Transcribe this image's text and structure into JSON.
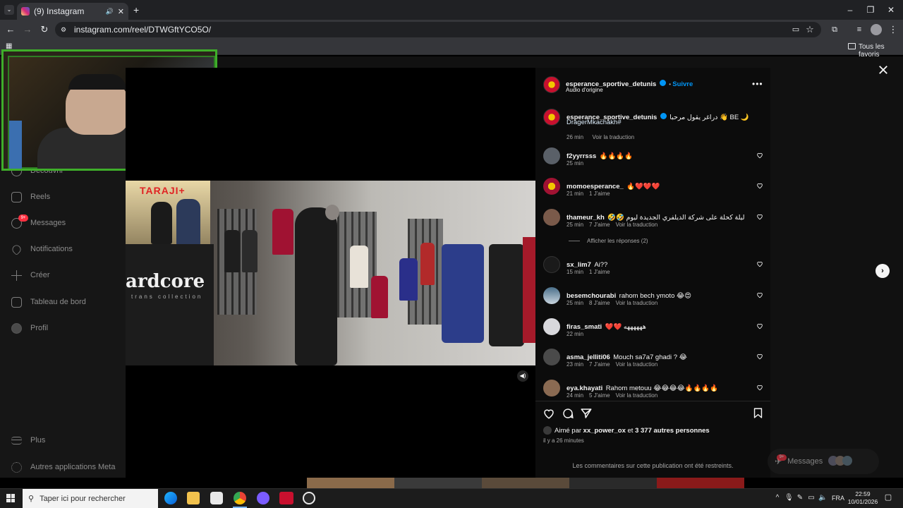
{
  "browser": {
    "tab_title": "(9) Instagram",
    "url": "instagram.com/reel/DTWGftYCO5O/",
    "bookmarks_folder": "Tous les favoris"
  },
  "sidebar": {
    "items": [
      {
        "label": "Découvrir",
        "icon": "compass-icon"
      },
      {
        "label": "Reels",
        "icon": "reels-icon"
      },
      {
        "label": "Messages",
        "icon": "messenger-icon"
      },
      {
        "label": "Notifications",
        "icon": "heart-icon"
      },
      {
        "label": "Créer",
        "icon": "plus-icon"
      },
      {
        "label": "Tableau de bord",
        "icon": "dashboard-icon"
      },
      {
        "label": "Profil",
        "icon": "avatar"
      }
    ],
    "messages_badge": "9+",
    "more": "Plus",
    "meta_apps": "Autres applications Meta"
  },
  "video": {
    "poster_text": "TARAJI+",
    "brand_text": "ardcore",
    "brand_sub": "trans collection",
    "muted_icon": "volume-icon"
  },
  "post": {
    "author": "esperance_sportive_detunis",
    "follow": "Suivre",
    "audio": "Audio d'origine",
    "caption_user": "esperance_sportive_detunis",
    "caption_text": "دراغر يقول مرحبا 👋 BE 🌙",
    "caption_hashtag": "DragerMkachakh#",
    "caption_time": "26 min",
    "caption_translate": "Voir la traduction"
  },
  "comments": [
    {
      "user": "f2yyrrsss",
      "text": "🔥🔥🔥🔥",
      "time": "25 min",
      "likes": "",
      "translate": ""
    },
    {
      "user": "momoesperance_",
      "text": "🔥❤️❤️❤️",
      "time": "21 min",
      "likes": "1 J'aime",
      "translate": ""
    },
    {
      "user": "thameur_kh",
      "text": "🤣🤣 ليلة كحلة على شركة الديلفري الجديدة ليوم",
      "time": "25 min",
      "likes": "7 J'aime",
      "translate": "Voir la traduction"
    },
    {
      "user": "sx_lim7",
      "text": "Ai??",
      "time": "15 min",
      "likes": "1 J'aime",
      "translate": ""
    },
    {
      "user": "besemchourabi",
      "text": "rahom bech ymoto 😂😍",
      "time": "25 min",
      "likes": "8 J'aime",
      "translate": "Voir la traduction"
    },
    {
      "user": "firas_smati",
      "text": "❤️❤️ ههههههه",
      "time": "22 min",
      "likes": "",
      "translate": ""
    },
    {
      "user": "asma_jelliti06",
      "text": "Mouch sa7a7 ghadi ? 😂",
      "time": "23 min",
      "likes": "7 J'aime",
      "translate": "Voir la traduction"
    },
    {
      "user": "eya.khayati",
      "text": "Rahom metouu 😂😂😂😂🔥🔥🔥🔥",
      "time": "24 min",
      "likes": "5 J'aime",
      "translate": "Voir la traduction"
    }
  ],
  "replies_toggle": "Afficher les réponses (2)",
  "liked_by": {
    "prefix": "Aimé par",
    "user": "xx_power_ox",
    "and": "et",
    "others": "3 377 autres personnes"
  },
  "posted_ago": "il y a 26 minutes",
  "restricted_notice": "Les commentaires sur cette publication ont été restreints.",
  "messages_pill": "Messages",
  "messages_pill_badge": "9+",
  "taskbar": {
    "search_placeholder": "Taper ici pour rechercher",
    "lang": "FRA",
    "time": "22:59",
    "date": "10/01/2026"
  },
  "colors": {
    "accent": "#0095f6",
    "webcam_border": "#3fae2a",
    "badge": "#ff3040"
  }
}
